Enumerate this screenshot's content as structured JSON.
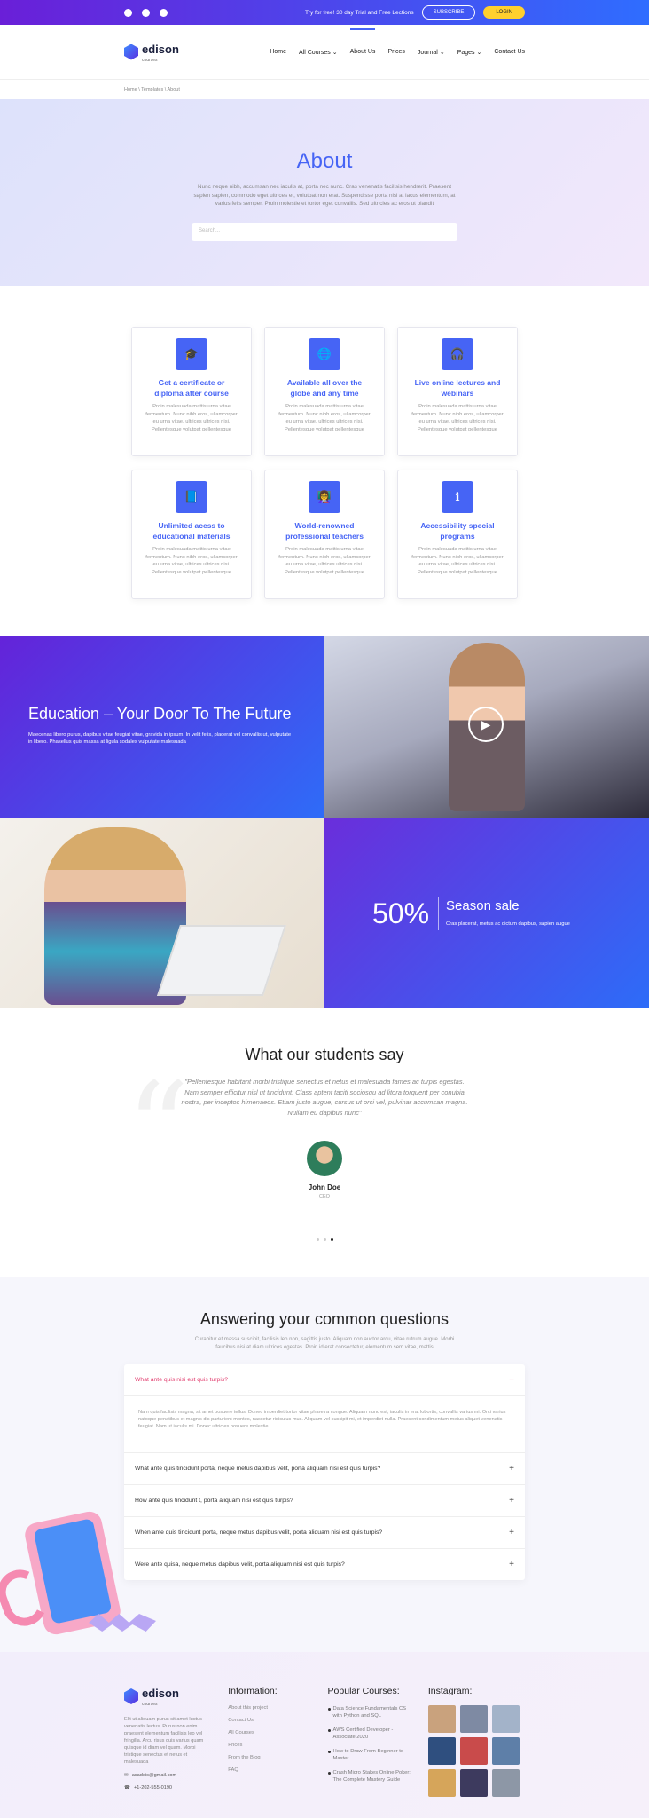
{
  "topbar": {
    "promo": "Try for free! 30 day Trial and Free Lections",
    "subscribe": "SUBSCRIBE",
    "login": "LOGIN",
    "social": [
      "facebook-icon",
      "youtube-icon",
      "instagram-icon"
    ]
  },
  "logo": {
    "name": "edison",
    "sub": "courses"
  },
  "nav": {
    "items": [
      "Home",
      "All Courses",
      "About Us",
      "Prices",
      "Journal",
      "Pages",
      "Contact Us"
    ],
    "active": "About Us"
  },
  "breadcrumb": "Home \\ Templates \\ About",
  "hero": {
    "title": "About",
    "text": "Nunc neque nibh, accumsan nec iaculis at, porta nec nunc. Cras venenatis facilisis hendrerit. Praesent sapien sapien, commodo eget ultrices et, volutpat non erat. Suspendisse porta nisl at lacus elementum, at varius felis semper. Proin molestie et tortor eget convallis. Sed ultricies ac eros ut blandit",
    "search_placeholder": "Search..."
  },
  "features": [
    {
      "icon": "graduation-icon",
      "glyph": "🎓",
      "title": "Get a certificate or diploma after course",
      "text": "Proin malesuada mattis urna vitae fermentum. Nunc nibh eros, ullamcorper eu urna vitae, ultrices ultrices nisi. Pellentesque volutpat pellentesque"
    },
    {
      "icon": "globe-icon",
      "glyph": "🌐",
      "title": "Available all over the globe and any time",
      "text": "Proin malesuada mattis urna vitae fermentum. Nunc nibh eros, ullamcorper eu urna vitae, ultrices ultrices nisi. Pellentesque volutpat pellentesque"
    },
    {
      "icon": "headset-icon",
      "glyph": "🎧",
      "title": "Live online lectures and webinars",
      "text": "Proin malesuada mattis urna vitae fermentum. Nunc nibh eros, ullamcorper eu urna vitae, ultrices ultrices nisi. Pellentesque volutpat pellentesque"
    },
    {
      "icon": "book-icon",
      "glyph": "📘",
      "title": "Unlimited acess to educational materials",
      "text": "Proin malesuada mattis urna vitae fermentum. Nunc nibh eros, ullamcorper eu urna vitae, ultrices ultrices nisi. Pellentesque volutpat pellentesque"
    },
    {
      "icon": "teacher-icon",
      "glyph": "👩‍🏫",
      "title": "World-renowned professional teachers",
      "text": "Proin malesuada mattis urna vitae fermentum. Nunc nibh eros, ullamcorper eu urna vitae, ultrices ultrices nisi. Pellentesque volutpat pellentesque"
    },
    {
      "icon": "info-icon",
      "glyph": "ℹ",
      "title": "Accessibility special programs",
      "text": "Proin malesuada mattis urna vitae fermentum. Nunc nibh eros, ullamcorper eu urna vitae, ultrices ultrices nisi. Pellentesque volutpat pellentesque"
    }
  ],
  "education": {
    "title": "Education – Your Door To The Future",
    "text": "Maecenas libero purus, dapibus vitae feugiat vitae, gravida in ipsum. In velit felis, placerat vel convallis ut, vulputate in libero. Phasellus quis massa at ligula sodales vulputate malesuada"
  },
  "sale": {
    "percent": "50%",
    "title": "Season sale",
    "text": "Cras placerat, metus ac dictum dapibus, sapien augue"
  },
  "testimonials": {
    "title": "What our students say",
    "quote": "\"Pellentesque habitant morbi tristique senectus et netus et malesuada fames ac turpis egestas. Nam semper efficitur nisl ut tincidunt. Class aptent taciti sociosqu ad litora torquent per conubia nostra, per inceptos himenaeos. Etiam justo augue, cursus ut orci vel, pulvinar accumsan magna. Nullam eu dapibus nunc\"",
    "name": "John Doe",
    "role": "CEO",
    "active_dot": 3
  },
  "faq": {
    "title": "Answering your common questions",
    "intro": "Curabitur et massa suscipit, facilisis leo non, sagittis justo. Aliquam non auctor arcu, vitae rutrum augue. Morbi faucibus nisi at diam ultrices egestas. Proin id erat consectetur, elementum sem vitae, mattis",
    "open": {
      "q": "What ante quis nisi est quis turpis?",
      "a": "Nam quis facilisis magna, sit amet posuere tellus. Donec imperdiet tortor vitae pharetra congue. Aliquam nunc est, iaculis in erat lobortis, convallis varius mi. Orci varius natoque penatibus et magnis dis parturient montes, nascetur ridiculus mus. Aliquam vel suscipit mi, et imperdiet nulla. Praesent condimentum metus aliquet venenatis feugiat. Nam ut iaculis mi. Donec ultricies posuere molestie"
    },
    "items": [
      "What ante quis tincidunt porta, neque metus dapibus velit, porta aliquam nisi est quis turpis?",
      "How ante quis tincidunt t, porta aliquam nisi est quis turpis?",
      "When ante quis tincidunt porta, neque metus dapibus velit, porta aliquam nisi est quis turpis?",
      "Were ante quisa, neque metus dapibus velit, porta aliquam nisi est quis turpis?"
    ]
  },
  "footer": {
    "about": "Elit ut aliquam purus sit amet luctus venenatis lectus. Purus non enim praesent elementum facilisis leo vel fringilla. Arcu risus quis varius quam quisque id diam vel quam. Morbi tristique senectus et netus et malesuada",
    "email": "acadeic@gmail.com",
    "phone": "+1-202-555-0190",
    "info_title": "Information:",
    "info_links": [
      "About this project",
      "Contact Us",
      "All Courses",
      "Prices",
      "From the Blog",
      "FAQ"
    ],
    "courses_title": "Popular Courses:",
    "courses": [
      "Data Science Fundamentals CS with Python and SQL",
      "AWS Certified Developer - Associate 2020",
      "How to Draw From Beginner to Master",
      "Crash Micro Stakes Online Poker: The Complete Mastery Guide"
    ],
    "insta_title": "Instagram:",
    "insta_colors": [
      "#c9a27d",
      "#7e8aa3",
      "#a3b3c9",
      "#2f4f7f",
      "#c94b4b",
      "#5e7fa8",
      "#d6a55a",
      "#3d3a5e",
      "#8d97a6"
    ]
  }
}
